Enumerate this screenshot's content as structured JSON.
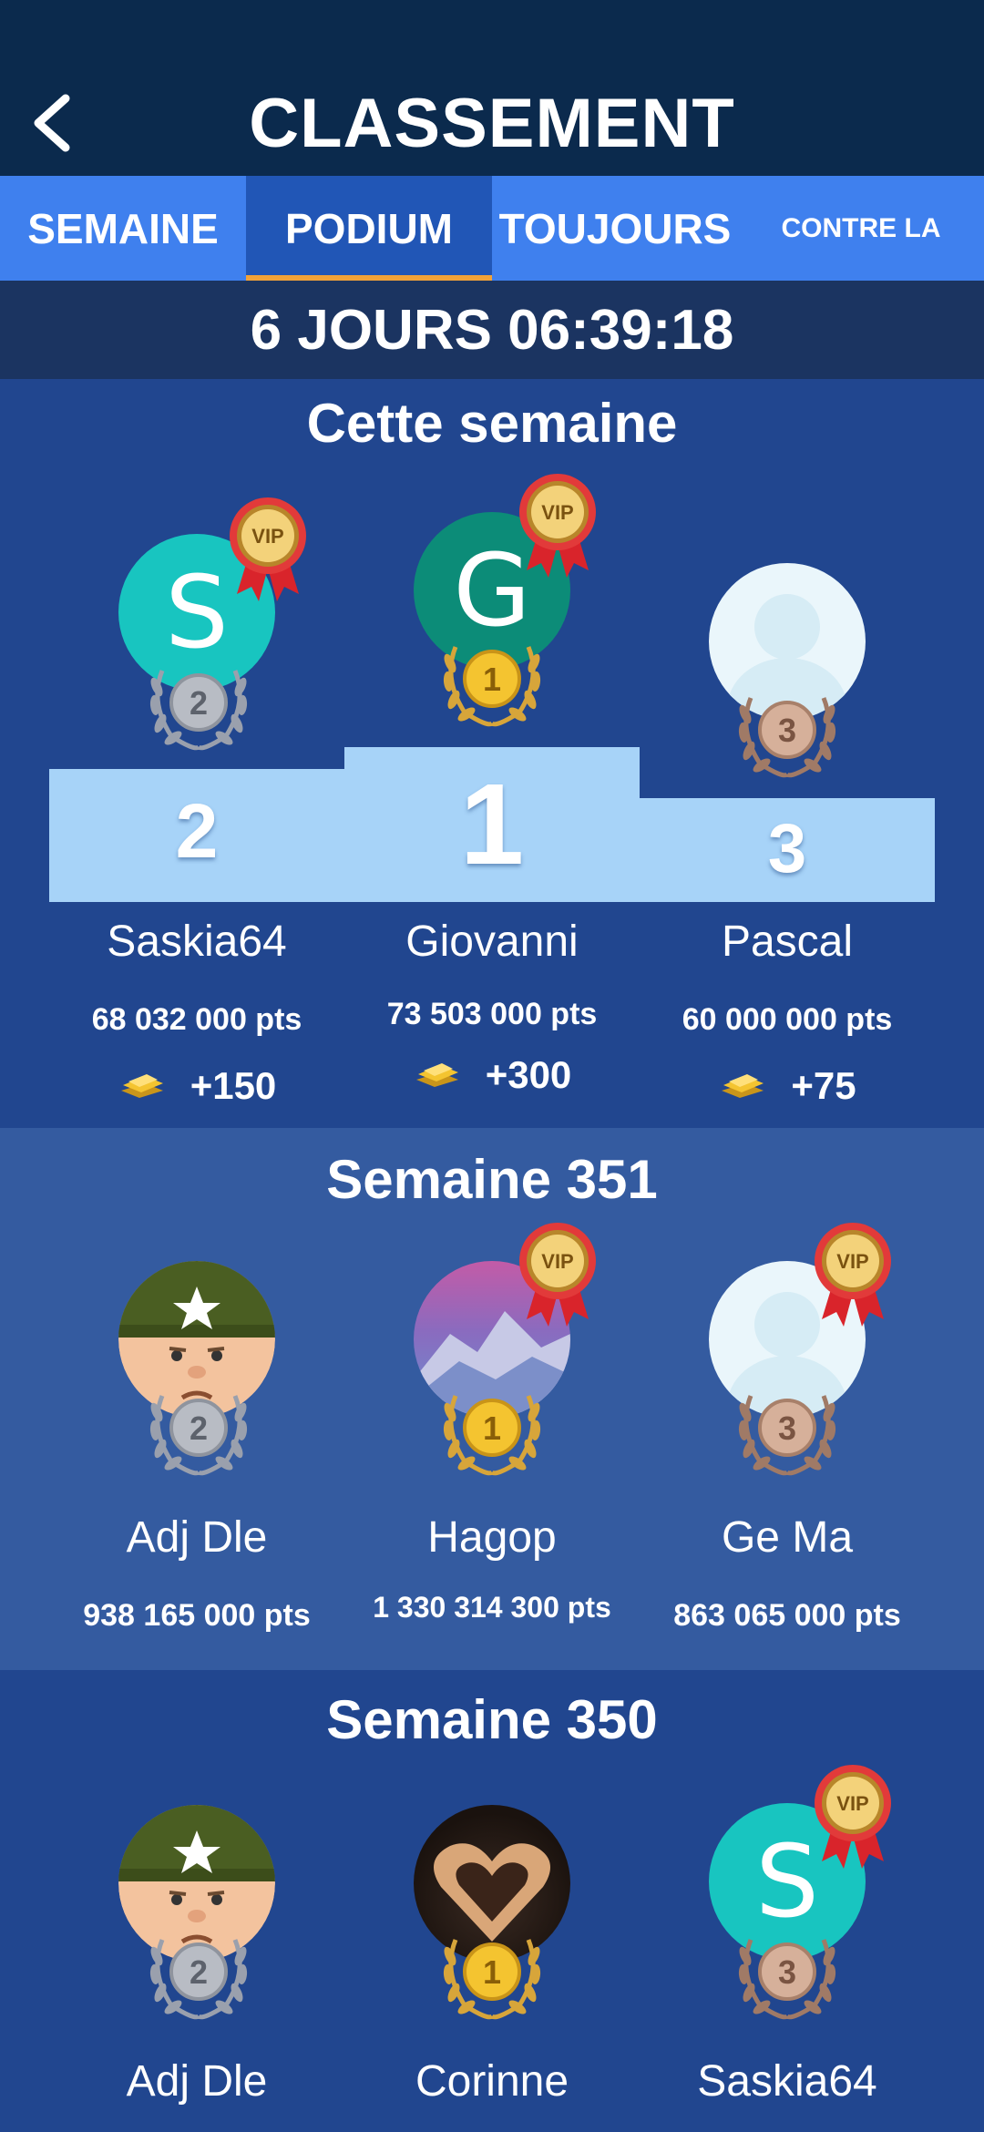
{
  "header": {
    "title": "CLASSEMENT"
  },
  "tabs": [
    {
      "label": "SEMAINE"
    },
    {
      "label": "PODIUM"
    },
    {
      "label": "TOUJOURS"
    },
    {
      "label": "CONTRE LA"
    }
  ],
  "active_tab": "PODIUM",
  "timer": "6 JOURS 06:39:18",
  "sections": [
    {
      "title": "Cette semaine",
      "podium_numbers": [
        "2",
        "1",
        "3"
      ],
      "players": [
        {
          "name": "Saskia64",
          "points": "68 032 000 pts",
          "reward": "+150",
          "rank": "2",
          "avatar_letter": "S",
          "vip": true
        },
        {
          "name": "Giovanni",
          "points": "73 503 000 pts",
          "reward": "+300",
          "rank": "1",
          "avatar_letter": "G",
          "vip": true
        },
        {
          "name": "Pascal",
          "points": "60 000 000 pts",
          "reward": "+75",
          "rank": "3",
          "avatar_letter": "",
          "vip": false
        }
      ]
    },
    {
      "title": "Semaine 351",
      "players": [
        {
          "name": "Adj Dle",
          "points": "938 165 000 pts",
          "rank": "2",
          "avatar": "soldier-avatar",
          "vip": false
        },
        {
          "name": "Hagop",
          "points": "1 330 314 300 pts",
          "rank": "1",
          "avatar": "mountain-photo-avatar",
          "vip": true
        },
        {
          "name": "Ge Ma",
          "points": "863 065 000 pts",
          "rank": "3",
          "avatar": "default-avatar",
          "vip": true
        }
      ]
    },
    {
      "title": "Semaine 350",
      "players": [
        {
          "name": "Adj Dle",
          "rank": "2",
          "avatar": "soldier-avatar",
          "vip": false
        },
        {
          "name": "Corinne",
          "rank": "1",
          "avatar": "heart-hands-photo-avatar",
          "vip": false
        },
        {
          "name": "Saskia64",
          "rank": "3",
          "avatar_letter": "S",
          "vip": true
        }
      ]
    }
  ],
  "vip_label": "VIP",
  "colors": {
    "header": "#0b2a4d",
    "tabs": "#3f80ee",
    "active_tab": "#2156b6",
    "tab_underline": "#f2a238",
    "timer_bar": "#1b3461",
    "section": "#21468f",
    "section_alt": "#345ba0",
    "podium": "#a7d3f8",
    "gold": "#f4c430",
    "silver": "#b8bcc4",
    "bronze": "#c9a08a"
  }
}
